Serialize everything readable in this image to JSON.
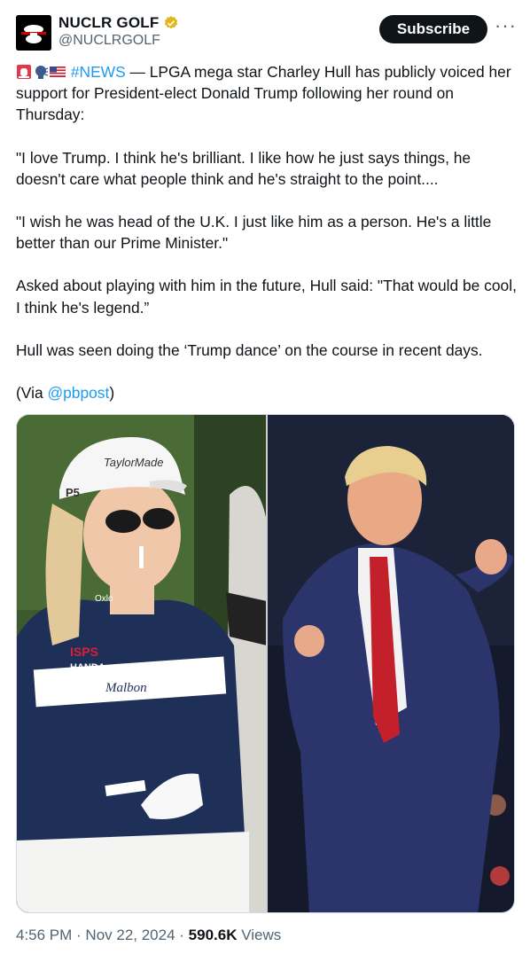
{
  "author": {
    "display_name": "NUCLR GOLF",
    "handle": "@NUCLRGOLF",
    "subscribe_label": "Subscribe",
    "more_label": "···"
  },
  "tweet": {
    "hashtag": "#NEWS",
    "line1": " — LPGA mega star Charley Hull has publicly voiced her support for President-elect Donald Trump following her round on Thursday:",
    "quote1": " \"I love Trump. I think he's brilliant. I like how he just says things, he doesn't care what people think and he's straight to the point....",
    "quote2": "\"I wish he was head of the U.K. I just like him as a person. He's a little better than our Prime Minister.\"",
    "para3": "Asked about playing with him in the future, Hull said: \"That would be cool, I think he's legend.”",
    "para4": "Hull was seen doing the ‘Trump dance’ on the course in recent days.",
    "via_prefix": "(Via ",
    "via_link": "@pbpost",
    "via_suffix": ")"
  },
  "media": {
    "left_cap_text": "TaylorMade",
    "left_cap_badge": "P5",
    "left_logo_isps": "ISPS",
    "left_logo_handa": "HANDA",
    "left_logo_malbon": "Malbon",
    "left_collar": "Oxlo"
  },
  "meta": {
    "time": "4:56 PM",
    "separator": " · ",
    "date": "Nov 22, 2024",
    "views_count": "590.6K",
    "views_label": " Views"
  },
  "colors": {
    "link": "#1d9bf0",
    "verified_gold": "#e2b719",
    "subscribe_bg": "#0f1419"
  }
}
